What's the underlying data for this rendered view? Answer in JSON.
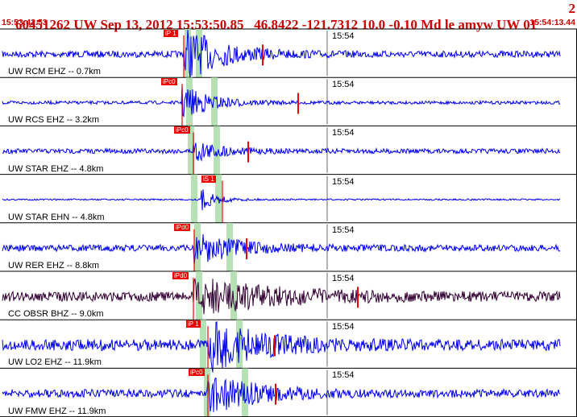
{
  "header": {
    "event_line": "60451262 UW Sep 13, 2012 15:53:50.85   46.8422 -121.7312 10.0 -0.10 Md le amyw UW 01",
    "page_number": "2",
    "start_time": "15:53:42.53",
    "end_time": "15:54:13.44"
  },
  "clock_tick": "15:54",
  "colors": {
    "trace": "#0000ee",
    "trace_alt": "#330033",
    "pick": "#ee0000",
    "window": "#a8dca8",
    "title": "#cc0000"
  },
  "channels": [
    {
      "label": "UW RCM EHZ -- 0.7km",
      "pick": "iP 1"
    },
    {
      "label": "UW RCS EHZ -- 3.2km",
      "pick": "iPc0"
    },
    {
      "label": "UW STAR EHZ -- 4.8km",
      "pick": "iPc0"
    },
    {
      "label": "UW STAR EHN -- 4.8km",
      "pick": "iS 1"
    },
    {
      "label": "UW RER EHZ -- 8.8km",
      "pick": "iPd0"
    },
    {
      "label": "CC OBSR BHZ -- 9.0km",
      "pick": "iPd0"
    },
    {
      "label": "UW LO2 EHZ -- 11.9km",
      "pick": "iP 1"
    },
    {
      "label": "UW FMW EHZ -- 11.9km",
      "pick": "iPc0"
    }
  ]
}
